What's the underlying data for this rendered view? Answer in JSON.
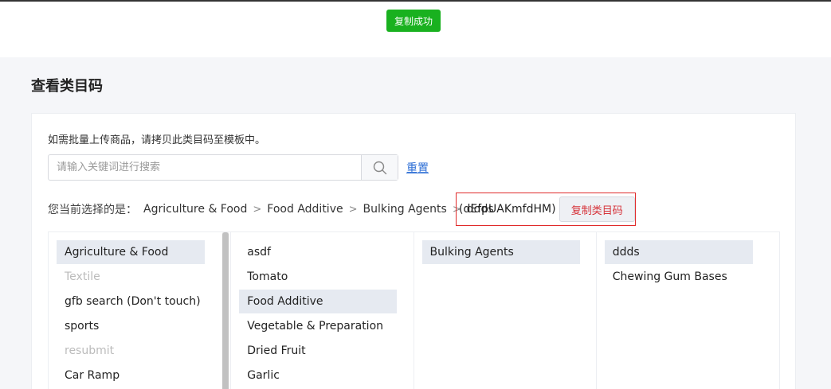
{
  "toast": "复制成功",
  "page_title": "查看类目码",
  "hint": "如需批量上传商品，请拷贝此类目码至模板中。",
  "search": {
    "placeholder": "请输入关键词进行搜索",
    "icon": "search-icon"
  },
  "reset_label": "重置",
  "current": {
    "label": "您当前选择的是：",
    "path": [
      "Agriculture & Food",
      "Food Additive",
      "Bulking Agents",
      "ddds"
    ],
    "separator": ">",
    "code": "(dEfpUAKmfdHM)",
    "copy_label": "复制类目码"
  },
  "columns": [
    {
      "items": [
        {
          "label": "Agriculture & Food",
          "state": "selected"
        },
        {
          "label": "Textile",
          "state": "disabled"
        },
        {
          "label": "gfb search (Don't touch)",
          "state": "normal"
        },
        {
          "label": "sports",
          "state": "normal"
        },
        {
          "label": "resubmit",
          "state": "disabled"
        },
        {
          "label": "Car Ramp",
          "state": "normal"
        }
      ]
    },
    {
      "items": [
        {
          "label": "asdf",
          "state": "normal"
        },
        {
          "label": "Tomato",
          "state": "normal"
        },
        {
          "label": "Food Additive",
          "state": "selected"
        },
        {
          "label": "Vegetable & Preparation",
          "state": "normal"
        },
        {
          "label": "Dried Fruit",
          "state": "normal"
        },
        {
          "label": "Garlic",
          "state": "normal"
        }
      ]
    },
    {
      "items": [
        {
          "label": "Bulking Agents",
          "state": "selected"
        }
      ]
    },
    {
      "items": [
        {
          "label": "ddds",
          "state": "selected"
        },
        {
          "label": "Chewing Gum Bases",
          "state": "normal"
        }
      ]
    }
  ],
  "colors": {
    "success": "#19b11f",
    "highlight_border": "#e02b2b",
    "link": "#2f6fd6",
    "selected_bg": "#e6eaf1"
  }
}
